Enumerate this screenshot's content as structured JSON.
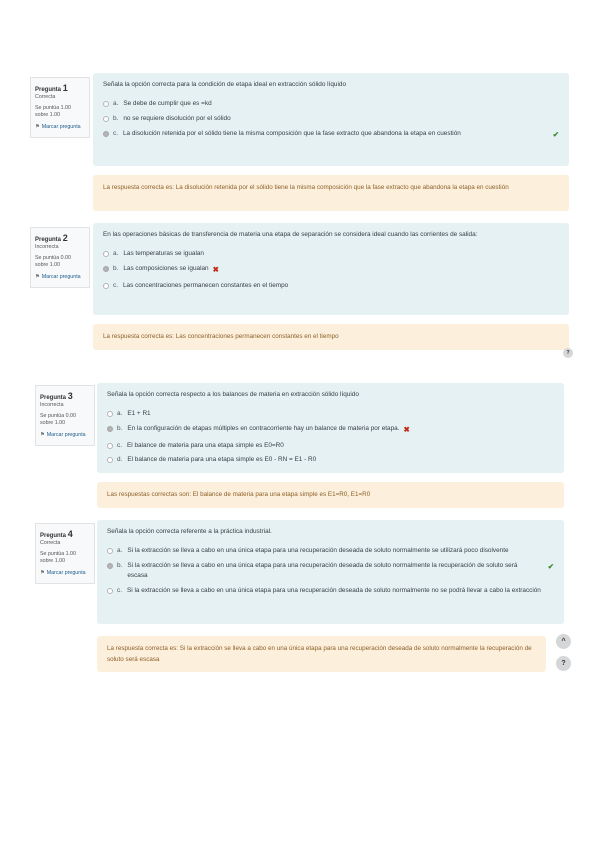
{
  "questions": [
    {
      "label": "Pregunta",
      "number": "1",
      "state": "Correcta",
      "score": "Se puntúa 1.00 sobre 1.00",
      "flag": "Marcar pregunta",
      "text": "Señala la opción correcta para la condición de etapa ideal en extracción sólido líquido",
      "answers": [
        {
          "letter": "a.",
          "text": "Se debe de cumplir que es =kd"
        },
        {
          "letter": "b.",
          "text": "no se requiere disolución por el sólido"
        },
        {
          "letter": "c.",
          "text": "La disolución retenida por el sólido tiene la misma composición que la fase extracto que abandona la etapa en cuestión",
          "mark": "✔"
        }
      ],
      "feedback": "La respuesta correcta es: La disolución retenida por el sólido tiene la misma composición que la fase extracto que abandona la etapa en cuestión"
    },
    {
      "label": "Pregunta",
      "number": "2",
      "state": "Incorrecta",
      "score": "Se puntúa 0.00 sobre 1.00",
      "flag": "Marcar pregunta",
      "text": "En las operaciones básicas de transferencia de materia una etapa de separación se considera ideal cuando las corrientes de salida:",
      "answers": [
        {
          "letter": "a.",
          "text": "Las temperaturas se igualan"
        },
        {
          "letter": "b.",
          "text": "Las composiciones se igualan",
          "mark": "✖"
        },
        {
          "letter": "c.",
          "text": "Las concentraciones permanecen constantes en el tiempo"
        }
      ],
      "feedback": "La respuesta correcta es: Las concentraciones permanecen constantes en el tiempo"
    },
    {
      "label": "Pregunta",
      "number": "3",
      "state": "Incorrecta",
      "score": "Se puntúa 0.00 sobre 1.00",
      "flag": "Marcar pregunta",
      "text": "Señala la opción correcta respecto a los balances de materia en extracción sólido líquido",
      "answers": [
        {
          "letter": "a.",
          "text": "E1 + R1"
        },
        {
          "letter": "b.",
          "text": "En la configuración de etapas múltiples en contracorriente hay un balance de materia por etapa.",
          "mark": "✖"
        },
        {
          "letter": "c.",
          "text": "El balance de materia para una etapa simple es E0=R0"
        },
        {
          "letter": "d.",
          "text": "El balance de materia para una etapa simple es E0 - RN = E1 - R0"
        }
      ],
      "feedback": "Las respuestas correctas son: El balance de materia para una etapa simple es E1=R0, E1=R0"
    },
    {
      "label": "Pregunta",
      "number": "4",
      "state": "Correcta",
      "score": "Se puntúa 1.00 sobre 1.00",
      "flag": "Marcar pregunta",
      "text": "Señala la opción correcta referente a la práctica industrial.",
      "answers": [
        {
          "letter": "a.",
          "text": "Si la extracción se lleva a cabo en una única etapa para una recuperación deseada de soluto normalmente se utilizará poco disolvente"
        },
        {
          "letter": "b.",
          "text": "Si la extracción se lleva a cabo en una única etapa para una recuperación deseada de soluto normalmente la recuperación de soluto será escasa",
          "mark": "✔"
        },
        {
          "letter": "c.",
          "text": "Si la extracción se lleva a cabo en una única etapa para una recuperación deseada de soluto normalmente no se podrá llevar a cabo la extracción"
        }
      ],
      "feedback": "La respuesta correcta es: Si la extracción se lleva a cabo en una única etapa para una recuperación deseada de soluto normalmente la recuperación de soluto será escasa"
    }
  ],
  "buttons": {
    "help": "?",
    "up": "^"
  }
}
